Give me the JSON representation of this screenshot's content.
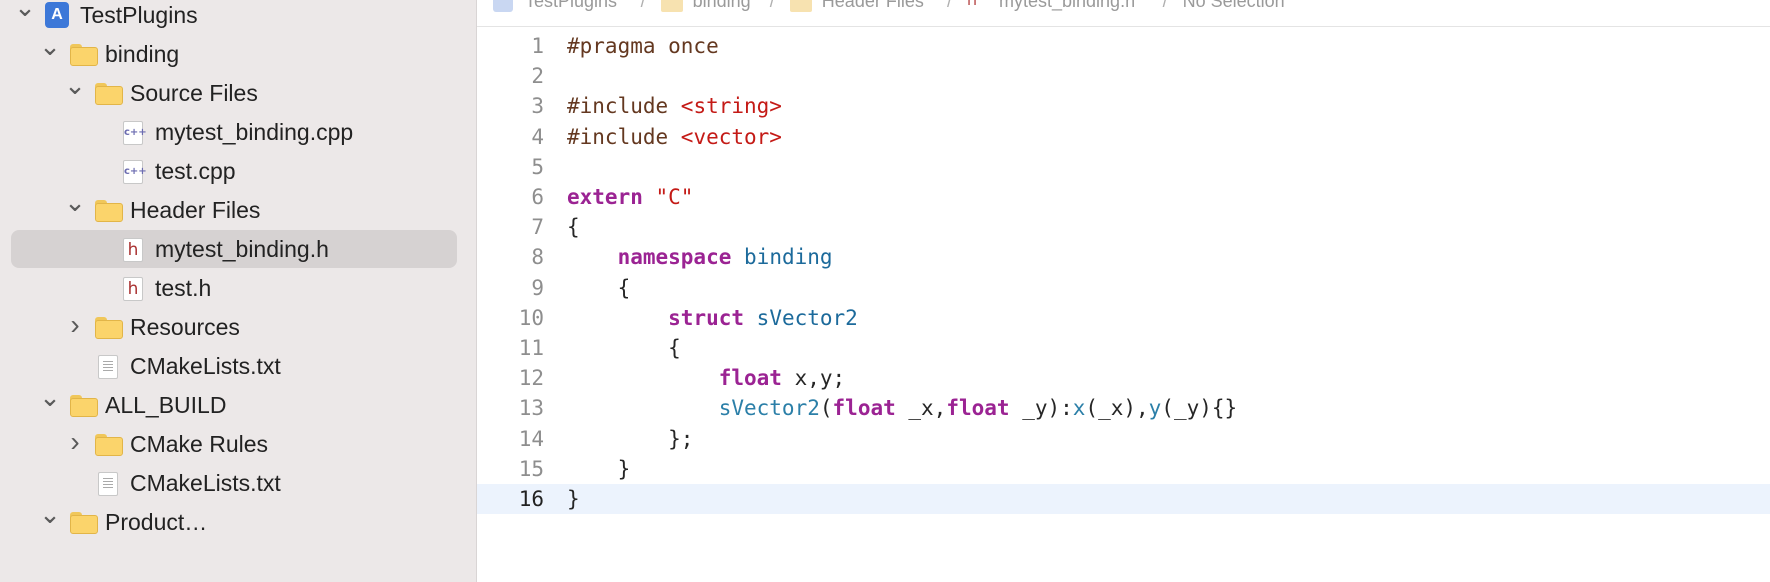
{
  "navigator": {
    "items": [
      {
        "label": "TestPlugins",
        "kind": "project",
        "depth": 0,
        "expand": "open",
        "selected": false
      },
      {
        "label": "binding",
        "kind": "folder",
        "depth": 1,
        "expand": "open",
        "selected": false
      },
      {
        "label": "Source Files",
        "kind": "folder",
        "depth": 2,
        "expand": "open",
        "selected": false
      },
      {
        "label": "mytest_binding.cpp",
        "kind": "cpp",
        "depth": 3,
        "expand": "none",
        "selected": false
      },
      {
        "label": "test.cpp",
        "kind": "cpp",
        "depth": 3,
        "expand": "none",
        "selected": false
      },
      {
        "label": "Header Files",
        "kind": "folder",
        "depth": 2,
        "expand": "open",
        "selected": false
      },
      {
        "label": "mytest_binding.h",
        "kind": "header",
        "depth": 3,
        "expand": "none",
        "selected": true
      },
      {
        "label": "test.h",
        "kind": "header",
        "depth": 3,
        "expand": "none",
        "selected": false
      },
      {
        "label": "Resources",
        "kind": "folder",
        "depth": 2,
        "expand": "closed",
        "selected": false
      },
      {
        "label": "CMakeLists.txt",
        "kind": "text",
        "depth": 2,
        "expand": "none",
        "selected": false
      },
      {
        "label": "ALL_BUILD",
        "kind": "folder",
        "depth": 1,
        "expand": "open",
        "selected": false
      },
      {
        "label": "CMake Rules",
        "kind": "folder",
        "depth": 2,
        "expand": "closed",
        "selected": false
      },
      {
        "label": "CMakeLists.txt",
        "kind": "text",
        "depth": 2,
        "expand": "none",
        "selected": false
      },
      {
        "label": "Product…",
        "kind": "folder",
        "depth": 1,
        "expand": "open",
        "selected": false
      }
    ],
    "icon_glyphs": {
      "cpp": "c++",
      "header": "h",
      "project": "A"
    }
  },
  "breadcrumb": {
    "items": [
      "TestPlugins",
      "binding",
      "Header Files",
      "mytest_binding.h",
      "No Selection"
    ],
    "separator": "/"
  },
  "editor": {
    "current_line": 16,
    "lines": [
      {
        "n": "1",
        "tokens": [
          [
            "pp",
            "#pragma once"
          ]
        ]
      },
      {
        "n": "2",
        "tokens": []
      },
      {
        "n": "3",
        "tokens": [
          [
            "pp",
            "#include "
          ],
          [
            "str",
            "<string>"
          ]
        ]
      },
      {
        "n": "4",
        "tokens": [
          [
            "pp",
            "#include "
          ],
          [
            "str",
            "<vector>"
          ]
        ]
      },
      {
        "n": "5",
        "tokens": []
      },
      {
        "n": "6",
        "tokens": [
          [
            "kw",
            "extern"
          ],
          [
            "t",
            " "
          ],
          [
            "str",
            "\"C\""
          ]
        ]
      },
      {
        "n": "7",
        "tokens": [
          [
            "t",
            "{"
          ]
        ]
      },
      {
        "n": "8",
        "tokens": [
          [
            "t",
            "    "
          ],
          [
            "kw",
            "namespace"
          ],
          [
            "t",
            " "
          ],
          [
            "ty",
            "binding"
          ]
        ]
      },
      {
        "n": "9",
        "tokens": [
          [
            "t",
            "    {"
          ]
        ]
      },
      {
        "n": "10",
        "tokens": [
          [
            "t",
            "        "
          ],
          [
            "kw",
            "struct"
          ],
          [
            "t",
            " "
          ],
          [
            "ty",
            "sVector2"
          ]
        ]
      },
      {
        "n": "11",
        "tokens": [
          [
            "t",
            "        {"
          ]
        ]
      },
      {
        "n": "12",
        "tokens": [
          [
            "t",
            "            "
          ],
          [
            "kw",
            "float"
          ],
          [
            "t",
            " x,y;"
          ]
        ]
      },
      {
        "n": "13",
        "tokens": [
          [
            "t",
            "            "
          ],
          [
            "fn",
            "sVector2"
          ],
          [
            "t",
            "("
          ],
          [
            "kw",
            "float"
          ],
          [
            "t",
            " _x,"
          ],
          [
            "kw",
            "float"
          ],
          [
            "t",
            " _y):"
          ],
          [
            "fn",
            "x"
          ],
          [
            "t",
            "(_x),"
          ],
          [
            "fn",
            "y"
          ],
          [
            "t",
            "(_y){}"
          ]
        ]
      },
      {
        "n": "14",
        "tokens": [
          [
            "t",
            "        };"
          ]
        ]
      },
      {
        "n": "15",
        "tokens": [
          [
            "t",
            "    }"
          ]
        ]
      },
      {
        "n": "16",
        "tokens": [
          [
            "t",
            "}"
          ]
        ]
      }
    ]
  },
  "colors": {
    "keyword": "#9b2393",
    "preprocessor": "#643820",
    "string": "#c41a16",
    "type": "#1c6a9b",
    "function": "#2b7fa8",
    "selection_row": "#d6d2d2",
    "current_line": "#ecf3fd"
  }
}
